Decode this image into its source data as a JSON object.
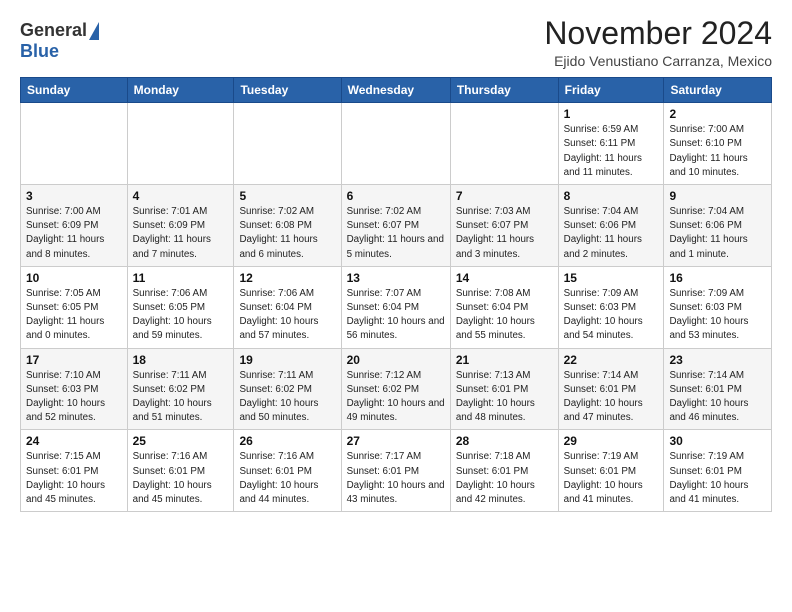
{
  "logo": {
    "general": "General",
    "blue": "Blue"
  },
  "header": {
    "month": "November 2024",
    "location": "Ejido Venustiano Carranza, Mexico"
  },
  "days": [
    "Sunday",
    "Monday",
    "Tuesday",
    "Wednesday",
    "Thursday",
    "Friday",
    "Saturday"
  ],
  "weeks": [
    [
      {
        "day": "",
        "info": ""
      },
      {
        "day": "",
        "info": ""
      },
      {
        "day": "",
        "info": ""
      },
      {
        "day": "",
        "info": ""
      },
      {
        "day": "",
        "info": ""
      },
      {
        "day": "1",
        "info": "Sunrise: 6:59 AM\nSunset: 6:11 PM\nDaylight: 11 hours and 11 minutes."
      },
      {
        "day": "2",
        "info": "Sunrise: 7:00 AM\nSunset: 6:10 PM\nDaylight: 11 hours and 10 minutes."
      }
    ],
    [
      {
        "day": "3",
        "info": "Sunrise: 7:00 AM\nSunset: 6:09 PM\nDaylight: 11 hours and 8 minutes."
      },
      {
        "day": "4",
        "info": "Sunrise: 7:01 AM\nSunset: 6:09 PM\nDaylight: 11 hours and 7 minutes."
      },
      {
        "day": "5",
        "info": "Sunrise: 7:02 AM\nSunset: 6:08 PM\nDaylight: 11 hours and 6 minutes."
      },
      {
        "day": "6",
        "info": "Sunrise: 7:02 AM\nSunset: 6:07 PM\nDaylight: 11 hours and 5 minutes."
      },
      {
        "day": "7",
        "info": "Sunrise: 7:03 AM\nSunset: 6:07 PM\nDaylight: 11 hours and 3 minutes."
      },
      {
        "day": "8",
        "info": "Sunrise: 7:04 AM\nSunset: 6:06 PM\nDaylight: 11 hours and 2 minutes."
      },
      {
        "day": "9",
        "info": "Sunrise: 7:04 AM\nSunset: 6:06 PM\nDaylight: 11 hours and 1 minute."
      }
    ],
    [
      {
        "day": "10",
        "info": "Sunrise: 7:05 AM\nSunset: 6:05 PM\nDaylight: 11 hours and 0 minutes."
      },
      {
        "day": "11",
        "info": "Sunrise: 7:06 AM\nSunset: 6:05 PM\nDaylight: 10 hours and 59 minutes."
      },
      {
        "day": "12",
        "info": "Sunrise: 7:06 AM\nSunset: 6:04 PM\nDaylight: 10 hours and 57 minutes."
      },
      {
        "day": "13",
        "info": "Sunrise: 7:07 AM\nSunset: 6:04 PM\nDaylight: 10 hours and 56 minutes."
      },
      {
        "day": "14",
        "info": "Sunrise: 7:08 AM\nSunset: 6:04 PM\nDaylight: 10 hours and 55 minutes."
      },
      {
        "day": "15",
        "info": "Sunrise: 7:09 AM\nSunset: 6:03 PM\nDaylight: 10 hours and 54 minutes."
      },
      {
        "day": "16",
        "info": "Sunrise: 7:09 AM\nSunset: 6:03 PM\nDaylight: 10 hours and 53 minutes."
      }
    ],
    [
      {
        "day": "17",
        "info": "Sunrise: 7:10 AM\nSunset: 6:03 PM\nDaylight: 10 hours and 52 minutes."
      },
      {
        "day": "18",
        "info": "Sunrise: 7:11 AM\nSunset: 6:02 PM\nDaylight: 10 hours and 51 minutes."
      },
      {
        "day": "19",
        "info": "Sunrise: 7:11 AM\nSunset: 6:02 PM\nDaylight: 10 hours and 50 minutes."
      },
      {
        "day": "20",
        "info": "Sunrise: 7:12 AM\nSunset: 6:02 PM\nDaylight: 10 hours and 49 minutes."
      },
      {
        "day": "21",
        "info": "Sunrise: 7:13 AM\nSunset: 6:01 PM\nDaylight: 10 hours and 48 minutes."
      },
      {
        "day": "22",
        "info": "Sunrise: 7:14 AM\nSunset: 6:01 PM\nDaylight: 10 hours and 47 minutes."
      },
      {
        "day": "23",
        "info": "Sunrise: 7:14 AM\nSunset: 6:01 PM\nDaylight: 10 hours and 46 minutes."
      }
    ],
    [
      {
        "day": "24",
        "info": "Sunrise: 7:15 AM\nSunset: 6:01 PM\nDaylight: 10 hours and 45 minutes."
      },
      {
        "day": "25",
        "info": "Sunrise: 7:16 AM\nSunset: 6:01 PM\nDaylight: 10 hours and 45 minutes."
      },
      {
        "day": "26",
        "info": "Sunrise: 7:16 AM\nSunset: 6:01 PM\nDaylight: 10 hours and 44 minutes."
      },
      {
        "day": "27",
        "info": "Sunrise: 7:17 AM\nSunset: 6:01 PM\nDaylight: 10 hours and 43 minutes."
      },
      {
        "day": "28",
        "info": "Sunrise: 7:18 AM\nSunset: 6:01 PM\nDaylight: 10 hours and 42 minutes."
      },
      {
        "day": "29",
        "info": "Sunrise: 7:19 AM\nSunset: 6:01 PM\nDaylight: 10 hours and 41 minutes."
      },
      {
        "day": "30",
        "info": "Sunrise: 7:19 AM\nSunset: 6:01 PM\nDaylight: 10 hours and 41 minutes."
      }
    ]
  ]
}
